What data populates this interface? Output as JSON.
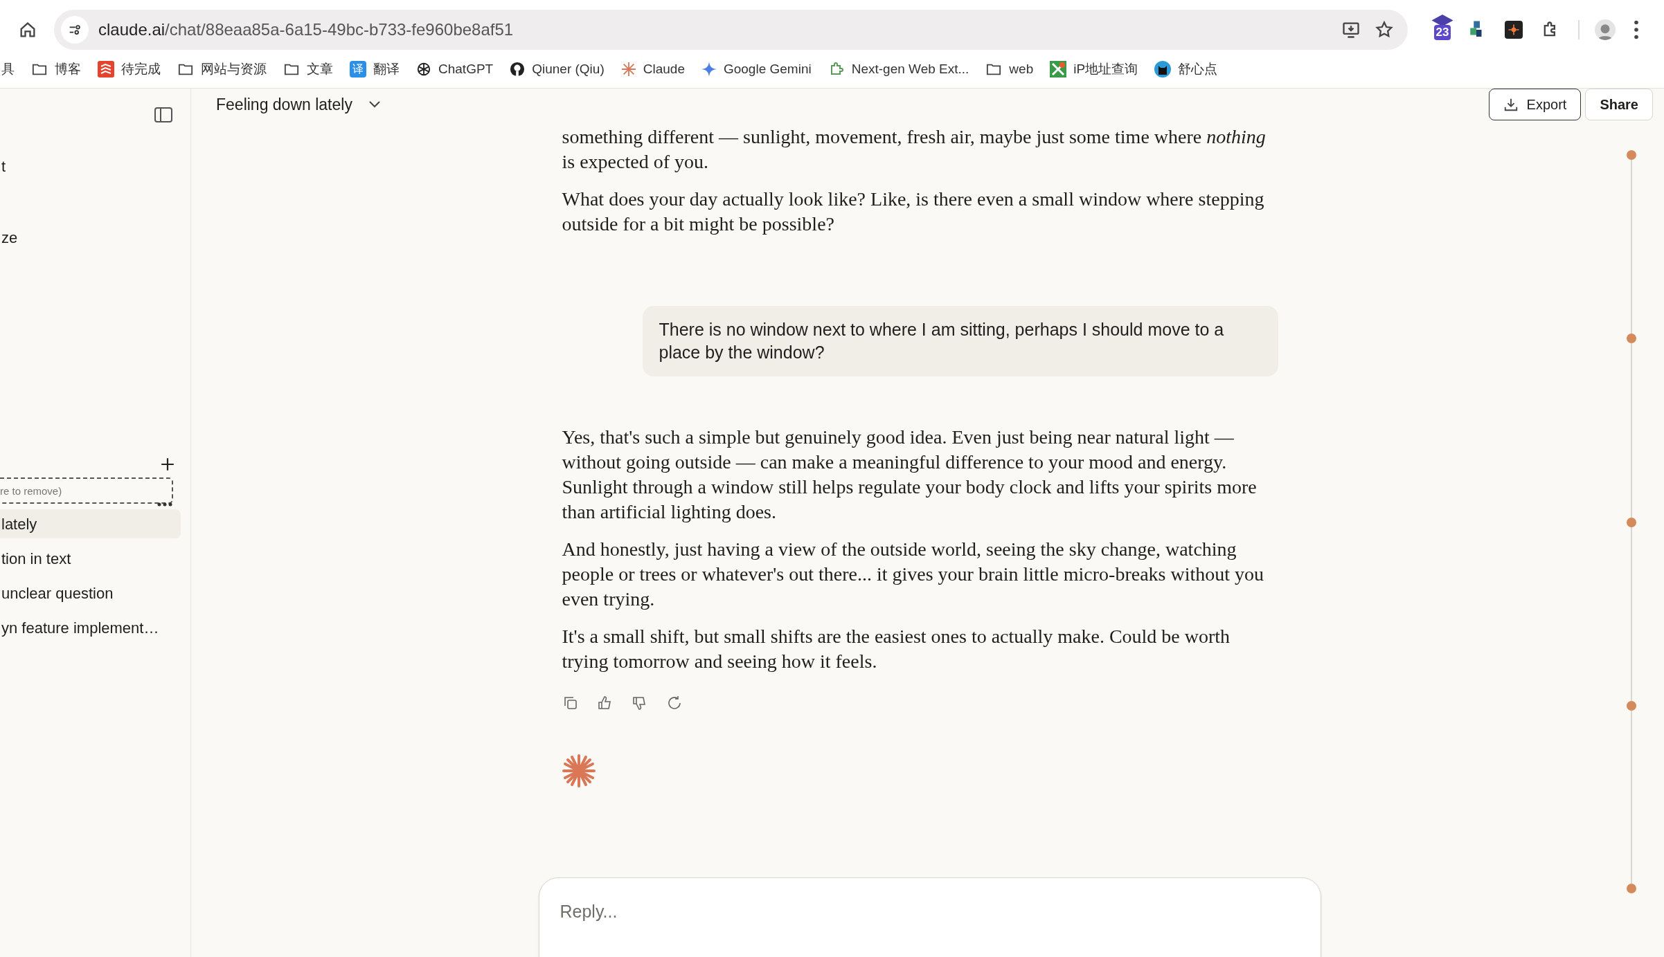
{
  "browser": {
    "url_host": "claude.ai",
    "url_path": "/chat/88eaa85a-6a15-49bc-b733-fe960be8af51",
    "extension_badge": "23",
    "bookmarks": [
      {
        "label": "具",
        "kind": "none"
      },
      {
        "label": "博客",
        "kind": "folder"
      },
      {
        "label": "待完成",
        "kind": "todo"
      },
      {
        "label": "网站与资源",
        "kind": "folder"
      },
      {
        "label": "文章",
        "kind": "folder"
      },
      {
        "label": "翻译",
        "kind": "translate",
        "icon_text": "译"
      },
      {
        "label": "ChatGPT",
        "kind": "chatgpt"
      },
      {
        "label": "Qiuner (Qiu)",
        "kind": "github"
      },
      {
        "label": "Claude",
        "kind": "claude"
      },
      {
        "label": "Google Gemini",
        "kind": "gemini"
      },
      {
        "label": "Next-gen Web Ext...",
        "kind": "puzzle"
      },
      {
        "label": "web",
        "kind": "folder"
      },
      {
        "label": "iP地址查询",
        "kind": "ip"
      },
      {
        "label": "舒心点",
        "kind": "cat"
      }
    ]
  },
  "sidebar": {
    "top_items": [
      "t",
      "ze"
    ],
    "drop_field": {
      "placeholder": "re to remove)"
    },
    "chats": [
      {
        "title": "lately",
        "selected": true
      },
      {
        "title": "tion in text",
        "selected": false
      },
      {
        "title": "unclear question",
        "selected": false
      },
      {
        "title": "yn feature implement…",
        "selected": false
      }
    ]
  },
  "header": {
    "title": "Feeling down lately",
    "buttons": [
      {
        "label": "Export",
        "kind": "export"
      },
      {
        "label": "Share",
        "kind": "plain"
      }
    ]
  },
  "messages": [
    {
      "kind": "assistant",
      "paragraphs": [
        "something different — sunlight, movement, fresh air, maybe just some time where *nothing* is expected of you.",
        "What does your day actually look like? Like, is there even a small window where stepping outside for a bit might be possible?"
      ]
    },
    {
      "kind": "user",
      "paragraphs": [
        "There is no window next to where I am sitting, perhaps I should move to a place by the window?"
      ]
    },
    {
      "kind": "assistant",
      "paragraphs": [
        "Yes, that's such a simple but genuinely good idea. Even just being near natural light — without going outside — can make a meaningful difference to your mood and energy. Sunlight through a window still helps regulate your body clock and lifts your spirits more than artificial lighting does.",
        "And honestly, just having a view of the outside world, seeing the sky change, watching people or trees or whatever's out there... it gives your brain little micro-breaks without you even trying.",
        "It's a small shift, but small shifts are the easiest ones to actually make. Could be worth trying tomorrow and seeing how it feels."
      ]
    }
  ],
  "composer": {
    "placeholder": "Reply..."
  }
}
